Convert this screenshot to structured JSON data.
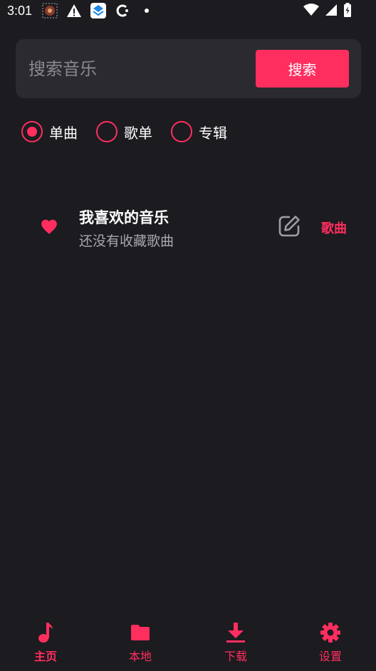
{
  "status_bar": {
    "time": "3:01"
  },
  "search": {
    "placeholder": "搜索音乐",
    "value": "",
    "button_label": "搜索"
  },
  "search_type": {
    "options": [
      {
        "label": "单曲",
        "checked": true
      },
      {
        "label": "歌单",
        "checked": false
      },
      {
        "label": "专辑",
        "checked": false
      }
    ]
  },
  "playlists": [
    {
      "title": "我喜欢的音乐",
      "subtitle": "还没有收藏歌曲",
      "type": "歌曲",
      "icon": "heart-icon"
    }
  ],
  "bottom_nav": {
    "items": [
      {
        "label": "主页",
        "icon": "music-note-icon",
        "active": true
      },
      {
        "label": "本地",
        "icon": "folder-icon",
        "active": false
      },
      {
        "label": "下载",
        "icon": "download-icon",
        "active": false
      },
      {
        "label": "设置",
        "icon": "gear-icon",
        "active": false
      }
    ]
  },
  "colors": {
    "accent": "#ff2e5f",
    "background": "#1c1b1f",
    "surface": "#2b2a2f"
  }
}
